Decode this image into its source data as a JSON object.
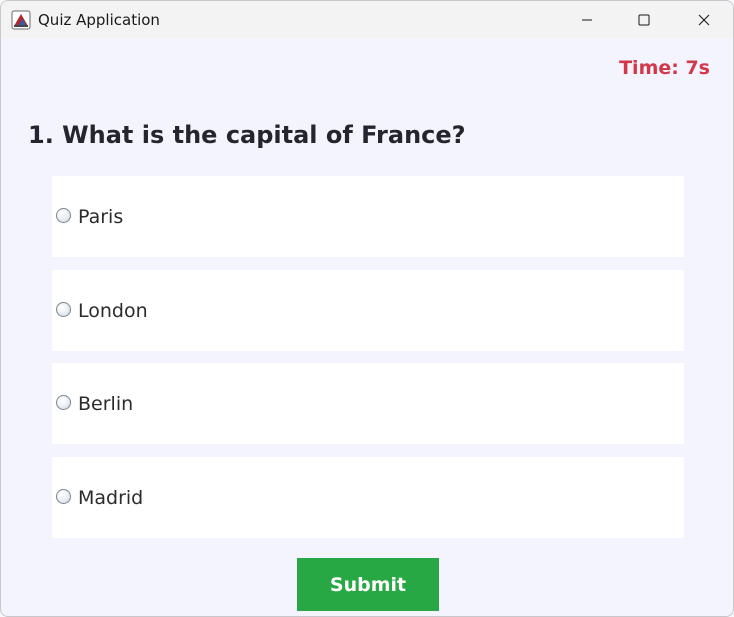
{
  "window": {
    "title": "Quiz Application",
    "app_icon": "java-coffee-icon",
    "controls": {
      "minimize_icon": "minimize-icon",
      "maximize_icon": "maximize-icon",
      "close_icon": "close-icon"
    }
  },
  "timer": {
    "text": "Time: 7s",
    "color": "#d2384a"
  },
  "question": {
    "text": "1. What is the capital of France?"
  },
  "options": [
    {
      "label": "Paris",
      "selected": false
    },
    {
      "label": "London",
      "selected": false
    },
    {
      "label": "Berlin",
      "selected": false
    },
    {
      "label": "Madrid",
      "selected": false
    }
  ],
  "submit": {
    "label": "Submit",
    "color": "#28a745"
  }
}
